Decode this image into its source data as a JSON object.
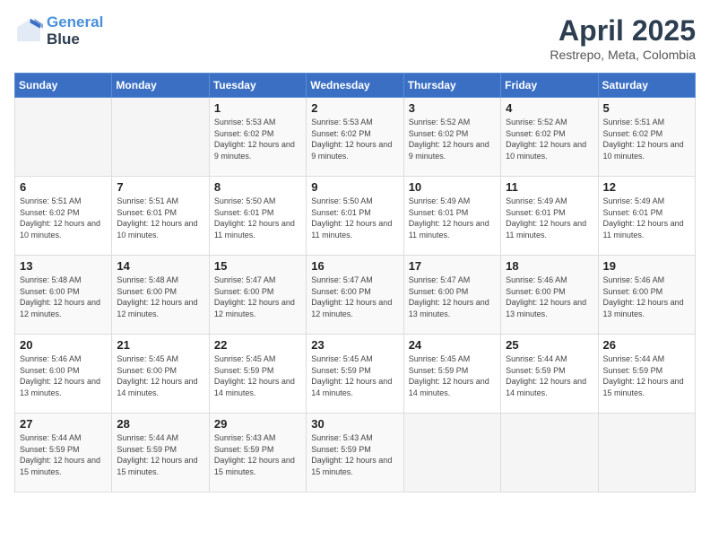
{
  "header": {
    "logo_line1": "General",
    "logo_line2": "Blue",
    "month": "April 2025",
    "location": "Restrepo, Meta, Colombia"
  },
  "weekdays": [
    "Sunday",
    "Monday",
    "Tuesday",
    "Wednesday",
    "Thursday",
    "Friday",
    "Saturday"
  ],
  "weeks": [
    [
      {
        "day": "",
        "info": ""
      },
      {
        "day": "",
        "info": ""
      },
      {
        "day": "1",
        "info": "Sunrise: 5:53 AM\nSunset: 6:02 PM\nDaylight: 12 hours and 9 minutes."
      },
      {
        "day": "2",
        "info": "Sunrise: 5:53 AM\nSunset: 6:02 PM\nDaylight: 12 hours and 9 minutes."
      },
      {
        "day": "3",
        "info": "Sunrise: 5:52 AM\nSunset: 6:02 PM\nDaylight: 12 hours and 9 minutes."
      },
      {
        "day": "4",
        "info": "Sunrise: 5:52 AM\nSunset: 6:02 PM\nDaylight: 12 hours and 10 minutes."
      },
      {
        "day": "5",
        "info": "Sunrise: 5:51 AM\nSunset: 6:02 PM\nDaylight: 12 hours and 10 minutes."
      }
    ],
    [
      {
        "day": "6",
        "info": "Sunrise: 5:51 AM\nSunset: 6:02 PM\nDaylight: 12 hours and 10 minutes."
      },
      {
        "day": "7",
        "info": "Sunrise: 5:51 AM\nSunset: 6:01 PM\nDaylight: 12 hours and 10 minutes."
      },
      {
        "day": "8",
        "info": "Sunrise: 5:50 AM\nSunset: 6:01 PM\nDaylight: 12 hours and 11 minutes."
      },
      {
        "day": "9",
        "info": "Sunrise: 5:50 AM\nSunset: 6:01 PM\nDaylight: 12 hours and 11 minutes."
      },
      {
        "day": "10",
        "info": "Sunrise: 5:49 AM\nSunset: 6:01 PM\nDaylight: 12 hours and 11 minutes."
      },
      {
        "day": "11",
        "info": "Sunrise: 5:49 AM\nSunset: 6:01 PM\nDaylight: 12 hours and 11 minutes."
      },
      {
        "day": "12",
        "info": "Sunrise: 5:49 AM\nSunset: 6:01 PM\nDaylight: 12 hours and 11 minutes."
      }
    ],
    [
      {
        "day": "13",
        "info": "Sunrise: 5:48 AM\nSunset: 6:00 PM\nDaylight: 12 hours and 12 minutes."
      },
      {
        "day": "14",
        "info": "Sunrise: 5:48 AM\nSunset: 6:00 PM\nDaylight: 12 hours and 12 minutes."
      },
      {
        "day": "15",
        "info": "Sunrise: 5:47 AM\nSunset: 6:00 PM\nDaylight: 12 hours and 12 minutes."
      },
      {
        "day": "16",
        "info": "Sunrise: 5:47 AM\nSunset: 6:00 PM\nDaylight: 12 hours and 12 minutes."
      },
      {
        "day": "17",
        "info": "Sunrise: 5:47 AM\nSunset: 6:00 PM\nDaylight: 12 hours and 13 minutes."
      },
      {
        "day": "18",
        "info": "Sunrise: 5:46 AM\nSunset: 6:00 PM\nDaylight: 12 hours and 13 minutes."
      },
      {
        "day": "19",
        "info": "Sunrise: 5:46 AM\nSunset: 6:00 PM\nDaylight: 12 hours and 13 minutes."
      }
    ],
    [
      {
        "day": "20",
        "info": "Sunrise: 5:46 AM\nSunset: 6:00 PM\nDaylight: 12 hours and 13 minutes."
      },
      {
        "day": "21",
        "info": "Sunrise: 5:45 AM\nSunset: 6:00 PM\nDaylight: 12 hours and 14 minutes."
      },
      {
        "day": "22",
        "info": "Sunrise: 5:45 AM\nSunset: 5:59 PM\nDaylight: 12 hours and 14 minutes."
      },
      {
        "day": "23",
        "info": "Sunrise: 5:45 AM\nSunset: 5:59 PM\nDaylight: 12 hours and 14 minutes."
      },
      {
        "day": "24",
        "info": "Sunrise: 5:45 AM\nSunset: 5:59 PM\nDaylight: 12 hours and 14 minutes."
      },
      {
        "day": "25",
        "info": "Sunrise: 5:44 AM\nSunset: 5:59 PM\nDaylight: 12 hours and 14 minutes."
      },
      {
        "day": "26",
        "info": "Sunrise: 5:44 AM\nSunset: 5:59 PM\nDaylight: 12 hours and 15 minutes."
      }
    ],
    [
      {
        "day": "27",
        "info": "Sunrise: 5:44 AM\nSunset: 5:59 PM\nDaylight: 12 hours and 15 minutes."
      },
      {
        "day": "28",
        "info": "Sunrise: 5:44 AM\nSunset: 5:59 PM\nDaylight: 12 hours and 15 minutes."
      },
      {
        "day": "29",
        "info": "Sunrise: 5:43 AM\nSunset: 5:59 PM\nDaylight: 12 hours and 15 minutes."
      },
      {
        "day": "30",
        "info": "Sunrise: 5:43 AM\nSunset: 5:59 PM\nDaylight: 12 hours and 15 minutes."
      },
      {
        "day": "",
        "info": ""
      },
      {
        "day": "",
        "info": ""
      },
      {
        "day": "",
        "info": ""
      }
    ]
  ]
}
